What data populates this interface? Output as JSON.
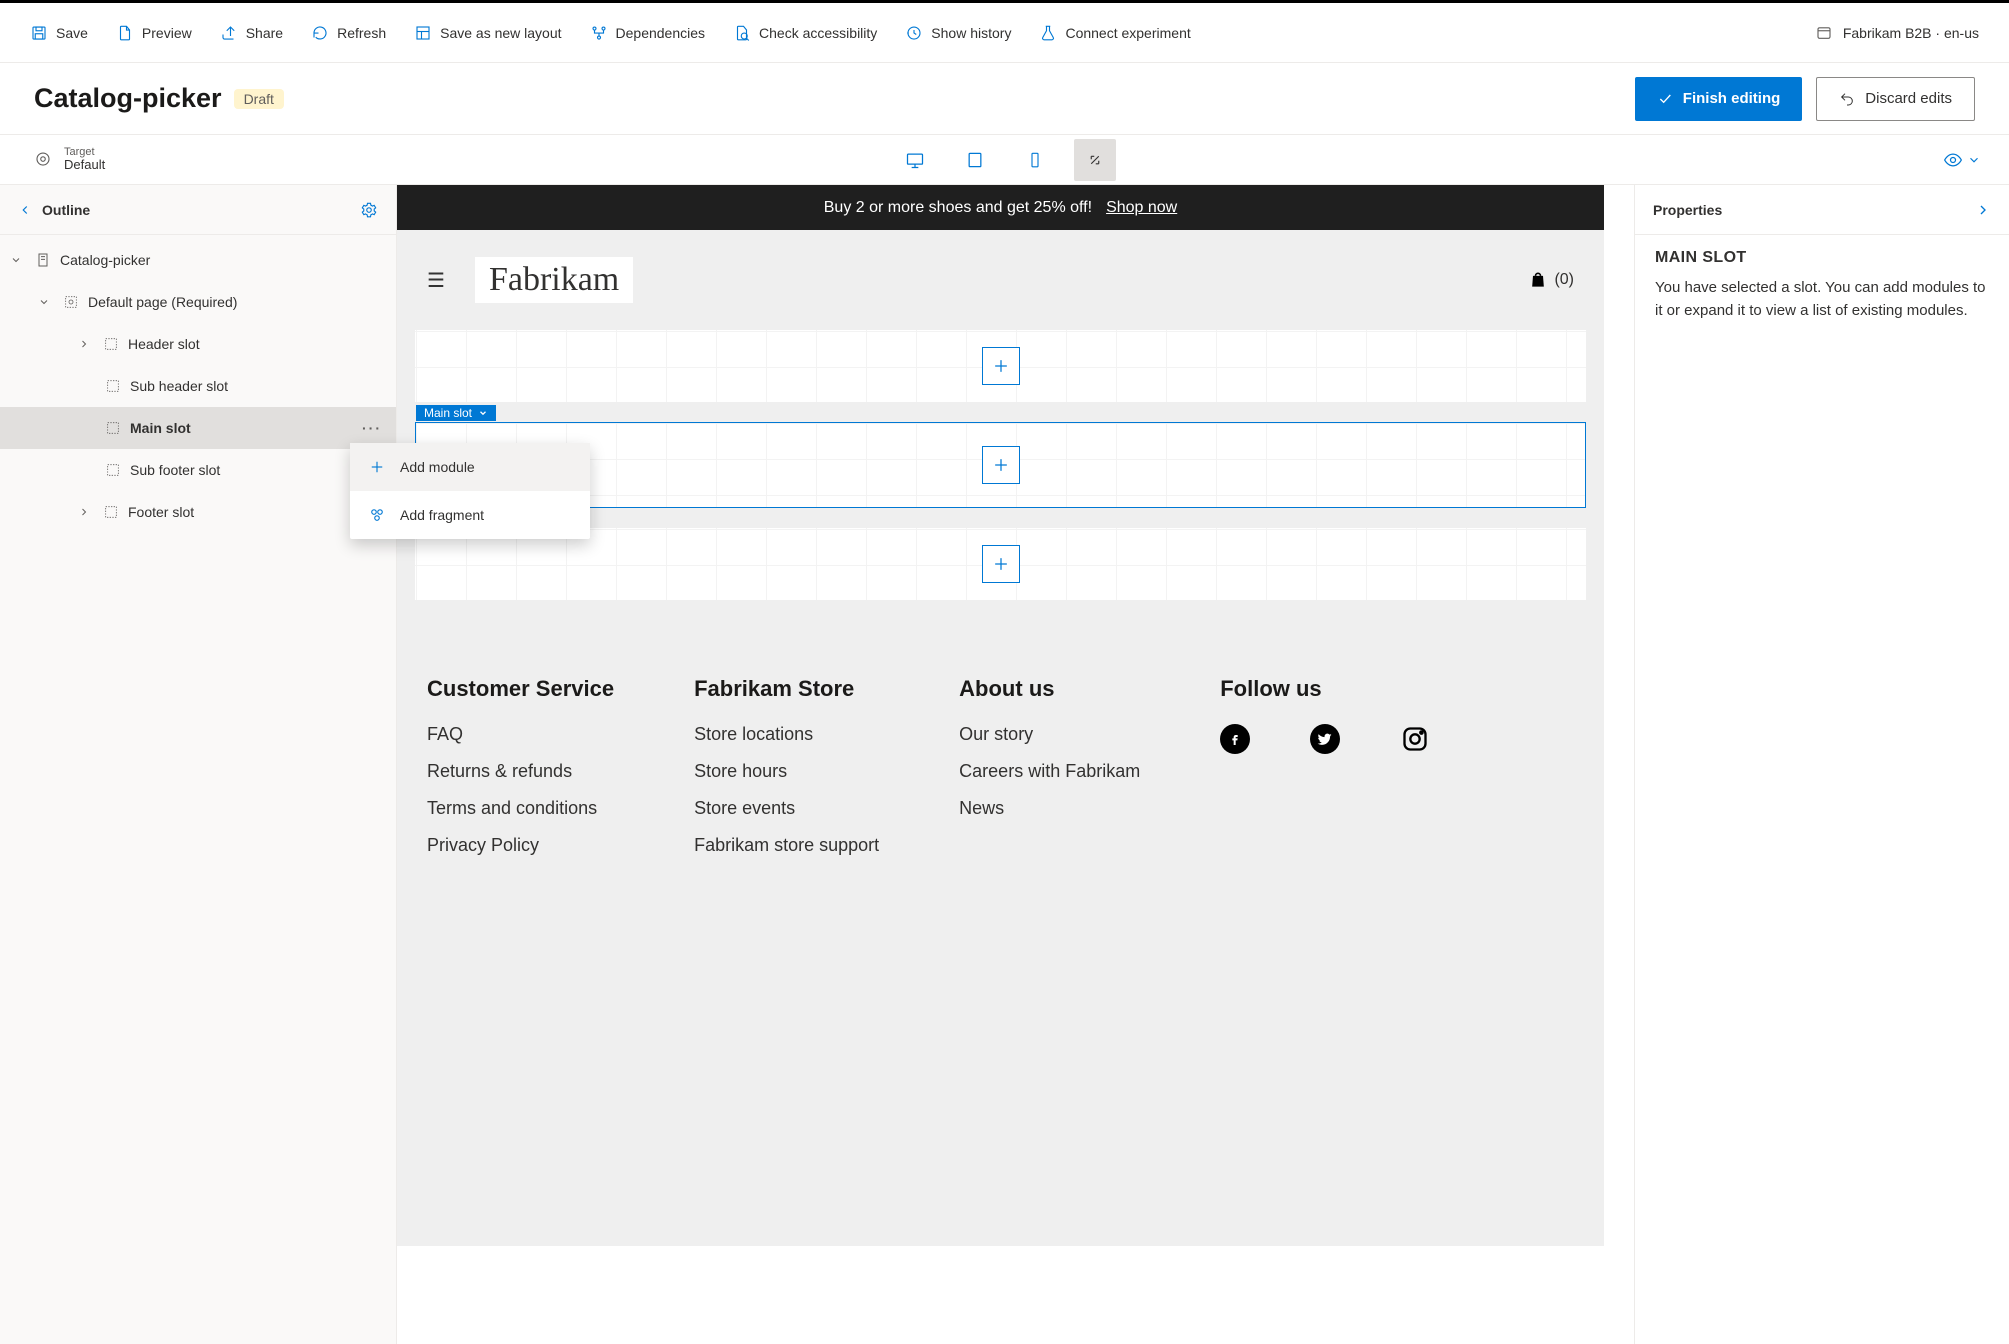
{
  "commandBar": {
    "items": [
      {
        "label": "Save",
        "icon": "save-icon"
      },
      {
        "label": "Preview",
        "icon": "preview-icon"
      },
      {
        "label": "Share",
        "icon": "share-icon"
      },
      {
        "label": "Refresh",
        "icon": "refresh-icon"
      },
      {
        "label": "Save as new layout",
        "icon": "layout-icon"
      },
      {
        "label": "Dependencies",
        "icon": "dependencies-icon"
      },
      {
        "label": "Check accessibility",
        "icon": "accessibility-icon"
      },
      {
        "label": "Show history",
        "icon": "history-icon"
      },
      {
        "label": "Connect experiment",
        "icon": "experiment-icon"
      }
    ],
    "context": "Fabrikam B2B · en-us"
  },
  "titleBar": {
    "title": "Catalog-picker",
    "status": "Draft",
    "finish": "Finish editing",
    "discard": "Discard edits"
  },
  "targetBar": {
    "label": "Target",
    "value": "Default"
  },
  "outline": {
    "header": "Outline",
    "root": "Catalog-picker",
    "page": "Default page (Required)",
    "slots": {
      "header": "Header slot",
      "subheader": "Sub header slot",
      "main": "Main slot",
      "subfooter": "Sub footer slot",
      "footer": "Footer slot"
    }
  },
  "contextMenu": {
    "addModule": "Add module",
    "addFragment": "Add fragment"
  },
  "canvas": {
    "promoText": "Buy 2 or more shoes and get 25% off!",
    "promoLink": "Shop now",
    "brand": "Fabrikam",
    "cartCount": "(0)",
    "mainSlotChip": "Main slot",
    "footer": {
      "cols": [
        {
          "title": "Customer Service",
          "links": [
            "FAQ",
            "Returns & refunds",
            "Terms and conditions",
            "Privacy Policy"
          ]
        },
        {
          "title": "Fabrikam Store",
          "links": [
            "Store locations",
            "Store hours",
            "Store events",
            "Fabrikam store support"
          ]
        },
        {
          "title": "About us",
          "links": [
            "Our story",
            "Careers with Fabrikam",
            "News"
          ]
        },
        {
          "title": "Follow us",
          "links": []
        }
      ]
    }
  },
  "props": {
    "header": "Properties",
    "sectionTitle": "MAIN SLOT",
    "description": "You have selected a slot. You can add modules to it or expand it to view a list of existing modules."
  }
}
